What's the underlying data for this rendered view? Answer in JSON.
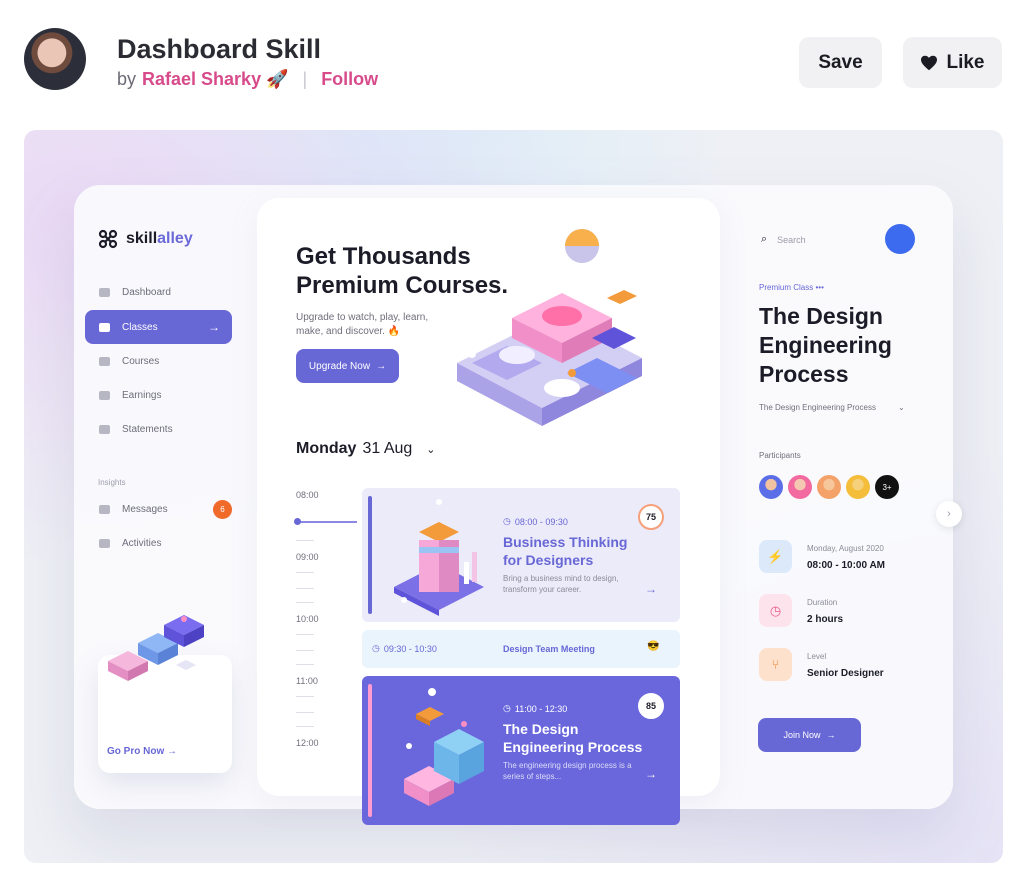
{
  "header": {
    "title": "Dashboard Skill",
    "by": "by",
    "author": "Rafael Sharky 🚀",
    "separator": "|",
    "follow": "Follow",
    "save": "Save",
    "like": "Like"
  },
  "app": {
    "logo_a": "skill",
    "logo_b": "alley",
    "nav": [
      "Dashboard",
      "Classes",
      "Courses",
      "Earnings",
      "Statements"
    ],
    "insights": "Insights",
    "insight_items": [
      "Messages",
      "Activities"
    ],
    "messages_badge": "6",
    "go_pro": "Go Pro Now"
  },
  "main": {
    "hero_title": "Get Thousands Premium Courses.",
    "hero_sub": "Upgrade to watch, play, learn, make, and discover. 🔥",
    "upgrade": "Upgrade Now",
    "day_name": "Monday",
    "day_date": "31 Aug",
    "times": [
      "08:00",
      "09:00",
      "10:00",
      "11:00",
      "12:00"
    ],
    "events": [
      {
        "time": "08:00 - 09:30",
        "title": "Business Thinking for Designers",
        "desc": "Bring a business mind to design, transform your career.",
        "score": "75"
      },
      {
        "time": "09:30 - 10:30",
        "title": "Design Team Meeting",
        "emoji": "😎"
      },
      {
        "time": "11:00 - 12:30",
        "title": "The Design Engineering Process",
        "desc": "The engineering design process is a series of steps...",
        "score": "85"
      }
    ]
  },
  "right": {
    "search": "Search",
    "premium": "Premium Class",
    "dots": "•••",
    "title": "The Design Engineering Process",
    "select": "The Design Engineering Process",
    "participants": "Participants",
    "more": "3+",
    "date_label": "Monday, August 2020",
    "date_value": "08:00 - 10:00 AM",
    "duration_label": "Duration",
    "duration_value": "2 hours",
    "level_label": "Level",
    "level_value": "Senior Designer",
    "join": "Join Now"
  },
  "colors": {
    "accent": "#6867d6",
    "author": "#d74b8b",
    "badge": "#f06a2a"
  }
}
